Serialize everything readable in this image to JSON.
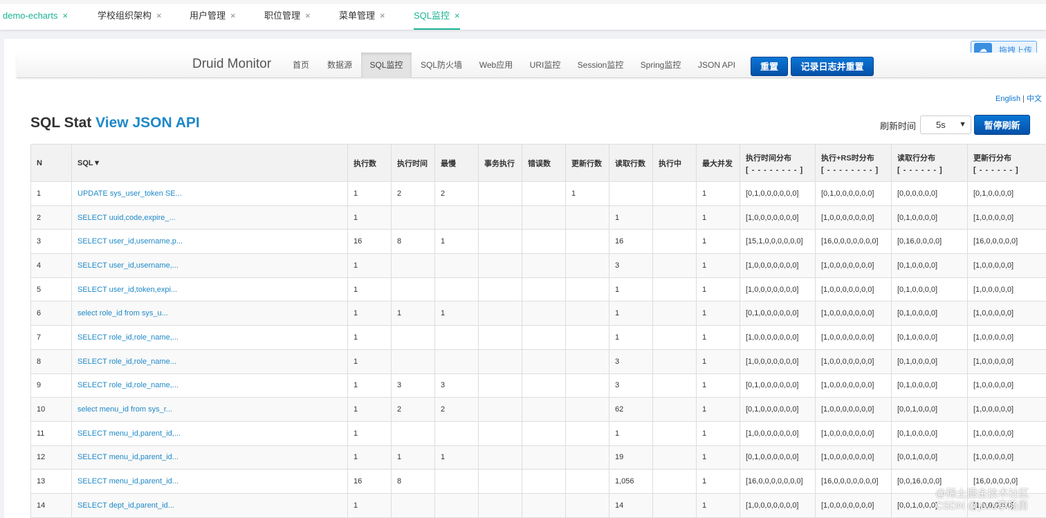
{
  "tabs": [
    {
      "label": "demo-echarts"
    },
    {
      "label": "学校组织架构"
    },
    {
      "label": "用户管理"
    },
    {
      "label": "职位管理"
    },
    {
      "label": "菜单管理"
    },
    {
      "label": "SQL监控"
    }
  ],
  "tab_close_glyph": "×",
  "upload": {
    "label": "拖拽上传",
    "icon": "cloud-icon"
  },
  "navbar": {
    "brand": "Druid Monitor",
    "items": [
      "首页",
      "数据源",
      "SQL监控",
      "SQL防火墙",
      "Web应用",
      "URI监控",
      "Session监控",
      "Spring监控",
      "JSON API"
    ],
    "active": "SQL监控",
    "reset_label": "重置",
    "log_reset_label": "记录日志并重置"
  },
  "lang": {
    "english": "English",
    "sep": "|",
    "chinese": "中文"
  },
  "page": {
    "title": "SQL Stat",
    "title_link": "View JSON API"
  },
  "refresh": {
    "label": "刷新时间",
    "selected": "5s",
    "pause_label": "暂停刷新"
  },
  "table": {
    "headers": [
      {
        "main": "N",
        "sub": ""
      },
      {
        "main": "SQL▼",
        "sub": ""
      },
      {
        "main": "执行数",
        "sub": ""
      },
      {
        "main": "执行时间",
        "sub": ""
      },
      {
        "main": "最慢",
        "sub": ""
      },
      {
        "main": "事务执行",
        "sub": ""
      },
      {
        "main": "错误数",
        "sub": ""
      },
      {
        "main": "更新行数",
        "sub": ""
      },
      {
        "main": "读取行数",
        "sub": ""
      },
      {
        "main": "执行中",
        "sub": ""
      },
      {
        "main": "最大并发",
        "sub": ""
      },
      {
        "main": "执行时间分布",
        "sub": "[ - - - - - - - - ]"
      },
      {
        "main": "执行+RS时分布",
        "sub": "[ - - - - - - - - ]"
      },
      {
        "main": "读取行分布",
        "sub": "[ - - - - - - ]"
      },
      {
        "main": "更新行分布",
        "sub": "[ - - - - - - ]"
      }
    ],
    "rows": [
      [
        "1",
        "UPDATE sys_user_token SE...",
        "1",
        "2",
        "2",
        "",
        "",
        "1",
        "",
        "",
        "1",
        "[0,1,0,0,0,0,0,0]",
        "[0,1,0,0,0,0,0,0]",
        "[0,0,0,0,0,0]",
        "[0,1,0,0,0,0]"
      ],
      [
        "2",
        "SELECT uuid,code,expire_...",
        "1",
        "",
        "",
        "",
        "",
        "",
        "1",
        "",
        "1",
        "[1,0,0,0,0,0,0,0]",
        "[1,0,0,0,0,0,0,0]",
        "[0,1,0,0,0,0]",
        "[1,0,0,0,0,0]"
      ],
      [
        "3",
        "SELECT user_id,username,p...",
        "16",
        "8",
        "1",
        "",
        "",
        "",
        "16",
        "",
        "1",
        "[15,1,0,0,0,0,0,0]",
        "[16,0,0,0,0,0,0,0]",
        "[0,16,0,0,0,0]",
        "[16,0,0,0,0,0]"
      ],
      [
        "4",
        "SELECT user_id,username,...",
        "1",
        "",
        "",
        "",
        "",
        "",
        "3",
        "",
        "1",
        "[1,0,0,0,0,0,0,0]",
        "[1,0,0,0,0,0,0,0]",
        "[0,1,0,0,0,0]",
        "[1,0,0,0,0,0]"
      ],
      [
        "5",
        "SELECT user_id,token,expi...",
        "1",
        "",
        "",
        "",
        "",
        "",
        "1",
        "",
        "1",
        "[1,0,0,0,0,0,0,0]",
        "[1,0,0,0,0,0,0,0]",
        "[0,1,0,0,0,0]",
        "[1,0,0,0,0,0]"
      ],
      [
        "6",
        "select role_id from sys_u...",
        "1",
        "1",
        "1",
        "",
        "",
        "",
        "1",
        "",
        "1",
        "[0,1,0,0,0,0,0,0]",
        "[1,0,0,0,0,0,0,0]",
        "[0,1,0,0,0,0]",
        "[1,0,0,0,0,0]"
      ],
      [
        "7",
        "SELECT role_id,role_name,...",
        "1",
        "",
        "",
        "",
        "",
        "",
        "1",
        "",
        "1",
        "[1,0,0,0,0,0,0,0]",
        "[1,0,0,0,0,0,0,0]",
        "[0,1,0,0,0,0]",
        "[1,0,0,0,0,0]"
      ],
      [
        "8",
        "SELECT role_id,role_name...",
        "1",
        "",
        "",
        "",
        "",
        "",
        "3",
        "",
        "1",
        "[1,0,0,0,0,0,0,0]",
        "[1,0,0,0,0,0,0,0]",
        "[0,1,0,0,0,0]",
        "[1,0,0,0,0,0]"
      ],
      [
        "9",
        "SELECT role_id,role_name,...",
        "1",
        "3",
        "3",
        "",
        "",
        "",
        "3",
        "",
        "1",
        "[0,1,0,0,0,0,0,0]",
        "[1,0,0,0,0,0,0,0]",
        "[0,1,0,0,0,0]",
        "[1,0,0,0,0,0]"
      ],
      [
        "10",
        "select menu_id from sys_r...",
        "1",
        "2",
        "2",
        "",
        "",
        "",
        "62",
        "",
        "1",
        "[0,1,0,0,0,0,0,0]",
        "[1,0,0,0,0,0,0,0]",
        "[0,0,1,0,0,0]",
        "[1,0,0,0,0,0]"
      ],
      [
        "11",
        "SELECT menu_id,parent_id,...",
        "1",
        "",
        "",
        "",
        "",
        "",
        "1",
        "",
        "1",
        "[1,0,0,0,0,0,0,0]",
        "[1,0,0,0,0,0,0,0]",
        "[0,1,0,0,0,0]",
        "[1,0,0,0,0,0]"
      ],
      [
        "12",
        "SELECT menu_id,parent_id...",
        "1",
        "1",
        "1",
        "",
        "",
        "",
        "19",
        "",
        "1",
        "[0,1,0,0,0,0,0,0]",
        "[1,0,0,0,0,0,0,0]",
        "[0,0,1,0,0,0]",
        "[1,0,0,0,0,0]"
      ],
      [
        "13",
        "SELECT menu_id,parent_id...",
        "16",
        "8",
        "",
        "",
        "",
        "",
        "1,056",
        "",
        "1",
        "[16,0,0,0,0,0,0,0]",
        "[16,0,0,0,0,0,0,0]",
        "[0,0,16,0,0,0]",
        "[16,0,0,0,0,0]"
      ],
      [
        "14",
        "SELECT dept_id,parent_id...",
        "1",
        "",
        "",
        "",
        "",
        "",
        "14",
        "",
        "1",
        "[1,0,0,0,0,0,0,0]",
        "[1,0,0,0,0,0,0,0]",
        "[0,0,1,0,0,0]",
        "[1,0,0,0,0,0]"
      ]
    ]
  },
  "watermark": {
    "line1": "@稀土掘金技术社区",
    "line2": "CSDN @java李杨勇"
  },
  "colors": {
    "accent_green": "#1ab394",
    "link_blue": "#1e88c7",
    "button_blue": "#0b76d6"
  }
}
